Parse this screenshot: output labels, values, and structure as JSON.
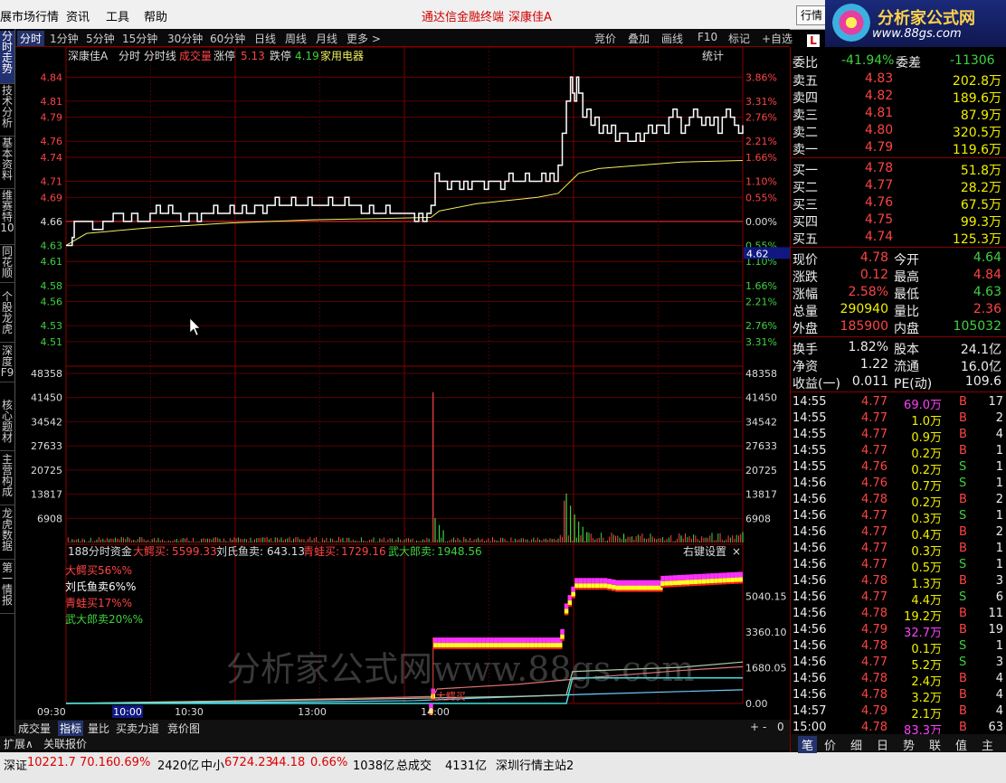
{
  "menubar": {
    "left_title": "展市场行情",
    "items": [
      "资讯",
      "工具",
      "帮助"
    ],
    "promo1": "通达信金融终端",
    "promo2": "深康佳A",
    "hq_button": "行情"
  },
  "logo": {
    "line1": "分析家公式网",
    "line2": "www.88gs.com"
  },
  "left_tabs": [
    "分时走势",
    "技术分析",
    "基本资料",
    "维赛特10",
    "同花顺",
    "个股龙虎",
    "深度F9",
    "核心题材",
    "主营构成",
    "龙虎数据",
    "第一情报"
  ],
  "toolbar": {
    "items": [
      "分时",
      "1分钟",
      "5分钟",
      "15分钟",
      "30分钟",
      "60分钟",
      "日线",
      "周线",
      "月线",
      "更多 >"
    ],
    "right_items": [
      "竞价",
      "叠加",
      "画线",
      "F10",
      "标记",
      "+自选"
    ]
  },
  "chart_header": {
    "stock": "深康佳A",
    "mode": "分时 分时线",
    "vol_label": "成交量",
    "zt_label": "涨停",
    "zt_val": "5.13",
    "dt_label": "跌停",
    "dt_val": "4.19",
    "industry": "家用电器",
    "stats": "统计"
  },
  "fund_header": {
    "title": "188分时资金",
    "s1_label": "大鳄买:",
    "s1_val": "5599.33",
    "s2_label": "刘氏鱼卖:",
    "s2_val": "643.13",
    "s3_label": "青蛙买:",
    "s3_val": "1729.16",
    "s4_label": "武大郎卖:",
    "s4_val": "1948.56",
    "settings": "右键设置"
  },
  "fund_legend": [
    "大鳄买56%%",
    "刘氏鱼卖6%%",
    "青蛙买17%%",
    "武大郎卖20%%"
  ],
  "fund_marker": "大鳄买",
  "watermark": "分析家公式网www.88gs.com",
  "bottom_tabs": [
    "成交量",
    "指标",
    "量比",
    "买卖力道",
    "竞价图"
  ],
  "bottom_right": [
    "+",
    "-",
    "0"
  ],
  "ext_tabs": [
    "扩展∧",
    "关联报价"
  ],
  "statusbar": {
    "sz_label": "深证",
    "sz_val": "10221.7",
    "sz_chg": "70.16",
    "sz_pct": "0.69%",
    "sz_amt": "2420亿",
    "zx_label": "中小",
    "zx_val": "6724.23",
    "zx_chg": "44.18",
    "zx_pct": "0.66%",
    "zx_amt": "1038亿",
    "total_label": "总成交",
    "total_val": "4131亿",
    "station": "深圳行情主站2"
  },
  "right_panel": {
    "commission": {
      "wb_label": "委比",
      "wb_val": "-41.94%",
      "wc_label": "委差",
      "wc_val": "-11306"
    },
    "sells": [
      {
        "label": "卖五",
        "price": "4.83",
        "vol": "202.8万"
      },
      {
        "label": "卖四",
        "price": "4.82",
        "vol": "189.6万"
      },
      {
        "label": "卖三",
        "price": "4.81",
        "vol": "87.9万"
      },
      {
        "label": "卖二",
        "price": "4.80",
        "vol": "320.5万"
      },
      {
        "label": "卖一",
        "price": "4.79",
        "vol": "119.6万"
      }
    ],
    "buys": [
      {
        "label": "买一",
        "price": "4.78",
        "vol": "51.8万"
      },
      {
        "label": "买二",
        "price": "4.77",
        "vol": "28.2万"
      },
      {
        "label": "买三",
        "price": "4.76",
        "vol": "67.5万"
      },
      {
        "label": "买四",
        "price": "4.75",
        "vol": "99.3万"
      },
      {
        "label": "买五",
        "price": "4.74",
        "vol": "125.3万"
      }
    ],
    "quote": [
      {
        "l1": "现价",
        "v1": "4.78",
        "l2": "今开",
        "v2": "4.64",
        "c1": "red",
        "c2": "grn"
      },
      {
        "l1": "涨跌",
        "v1": "0.12",
        "l2": "最高",
        "v2": "4.84",
        "c1": "red",
        "c2": "red"
      },
      {
        "l1": "涨幅",
        "v1": "2.58%",
        "l2": "最低",
        "v2": "4.63",
        "c1": "red",
        "c2": "grn"
      },
      {
        "l1": "总量",
        "v1": "290940",
        "l2": "量比",
        "v2": "2.36",
        "c1": "yel",
        "c2": "red"
      },
      {
        "l1": "外盘",
        "v1": "185900",
        "l2": "内盘",
        "v2": "105032",
        "c1": "red",
        "c2": "grn"
      }
    ],
    "fin": [
      {
        "l1": "换手",
        "v1": "1.82%",
        "l2": "股本",
        "v2": "24.1亿"
      },
      {
        "l1": "净资",
        "v1": "1.22",
        "l2": "流通",
        "v2": "16.0亿"
      },
      {
        "l1": "收益(一)",
        "v1": "0.011",
        "l2": "PE(动)",
        "v2": "109.6"
      }
    ],
    "ticks": [
      {
        "t": "14:55",
        "p": "4.77",
        "v": "69.0万",
        "d": "B",
        "n": "17",
        "pc": "red",
        "vc": "mag"
      },
      {
        "t": "14:55",
        "p": "4.77",
        "v": "1.0万",
        "d": "B",
        "n": "2",
        "pc": "red",
        "vc": "yel"
      },
      {
        "t": "14:55",
        "p": "4.77",
        "v": "0.9万",
        "d": "B",
        "n": "4",
        "pc": "red",
        "vc": "yel"
      },
      {
        "t": "14:55",
        "p": "4.77",
        "v": "0.2万",
        "d": "B",
        "n": "1",
        "pc": "red",
        "vc": "yel"
      },
      {
        "t": "14:55",
        "p": "4.76",
        "v": "0.2万",
        "d": "S",
        "n": "1",
        "pc": "red",
        "vc": "yel"
      },
      {
        "t": "14:56",
        "p": "4.76",
        "v": "0.7万",
        "d": "S",
        "n": "1",
        "pc": "red",
        "vc": "yel"
      },
      {
        "t": "14:56",
        "p": "4.78",
        "v": "0.2万",
        "d": "B",
        "n": "2",
        "pc": "red",
        "vc": "yel"
      },
      {
        "t": "14:56",
        "p": "4.77",
        "v": "0.3万",
        "d": "S",
        "n": "1",
        "pc": "red",
        "vc": "yel"
      },
      {
        "t": "14:56",
        "p": "4.77",
        "v": "0.4万",
        "d": "B",
        "n": "2",
        "pc": "red",
        "vc": "yel"
      },
      {
        "t": "14:56",
        "p": "4.77",
        "v": "0.3万",
        "d": "B",
        "n": "1",
        "pc": "red",
        "vc": "yel"
      },
      {
        "t": "14:56",
        "p": "4.77",
        "v": "0.5万",
        "d": "S",
        "n": "1",
        "pc": "red",
        "vc": "yel"
      },
      {
        "t": "14:56",
        "p": "4.78",
        "v": "1.3万",
        "d": "B",
        "n": "3",
        "pc": "red",
        "vc": "yel"
      },
      {
        "t": "14:56",
        "p": "4.77",
        "v": "4.4万",
        "d": "S",
        "n": "6",
        "pc": "red",
        "vc": "yel"
      },
      {
        "t": "14:56",
        "p": "4.78",
        "v": "19.2万",
        "d": "B",
        "n": "11",
        "pc": "red",
        "vc": "yel"
      },
      {
        "t": "14:56",
        "p": "4.79",
        "v": "32.7万",
        "d": "B",
        "n": "19",
        "pc": "red",
        "vc": "mag"
      },
      {
        "t": "14:56",
        "p": "4.78",
        "v": "0.1万",
        "d": "S",
        "n": "1",
        "pc": "red",
        "vc": "yel"
      },
      {
        "t": "14:56",
        "p": "4.77",
        "v": "5.2万",
        "d": "S",
        "n": "3",
        "pc": "red",
        "vc": "yel"
      },
      {
        "t": "14:56",
        "p": "4.78",
        "v": "2.4万",
        "d": "B",
        "n": "4",
        "pc": "red",
        "vc": "yel"
      },
      {
        "t": "14:56",
        "p": "4.78",
        "v": "3.2万",
        "d": "B",
        "n": "4",
        "pc": "red",
        "vc": "yel"
      },
      {
        "t": "14:57",
        "p": "4.79",
        "v": "2.1万",
        "d": "B",
        "n": "4",
        "pc": "red",
        "vc": "yel"
      },
      {
        "t": "15:00",
        "p": "4.78",
        "v": "83.3万",
        "d": "B",
        "n": "63",
        "pc": "red",
        "vc": "mag"
      }
    ],
    "bottom_tabs": [
      "笔",
      "价",
      "细",
      "日",
      "势",
      "联",
      "值",
      "主"
    ],
    "l_icon": "L"
  },
  "colors": {
    "price_line": "#ffffff",
    "avg_line": "#f0f060",
    "up": "#ff4444",
    "down": "#3fd23f",
    "grid": "#8b0000"
  },
  "chart_data": {
    "type": "line",
    "title": "深康佳A 分时线",
    "price_ylim": [
      4.485,
      4.855
    ],
    "preclose": 4.66,
    "price_ticks": [
      "4.84",
      "4.81",
      "4.79",
      "4.76",
      "4.74",
      "4.71",
      "4.69",
      "4.66",
      "4.63",
      "4.61",
      "4.58",
      "4.56",
      "4.53",
      "4.51"
    ],
    "pct_ticks": [
      "3.86%",
      "3.31%",
      "2.76%",
      "2.21%",
      "1.66%",
      "1.10%",
      "0.55%",
      "0.00%",
      "0.55%",
      "1.10%",
      "1.66%",
      "2.21%",
      "2.76%",
      "3.31%"
    ],
    "current_tag": "4.62",
    "vol_ticks": [
      "48358",
      "41450",
      "34542",
      "27633",
      "20725",
      "13817",
      "6908"
    ],
    "vol_ylim": [
      0,
      48358
    ],
    "fund_ticks": [
      "5040.15",
      "3360.10",
      "1680.05",
      "0.00"
    ],
    "fund_ylim": [
      0,
      6720
    ],
    "x_ticks": [
      "09:30",
      "10:00",
      "10:30",
      "13:00",
      "14:00"
    ],
    "price": [
      [
        0,
        4.63
      ],
      [
        2,
        4.63
      ],
      [
        3,
        4.64
      ],
      [
        4,
        4.66
      ],
      [
        12,
        4.66
      ],
      [
        13,
        4.65
      ],
      [
        17,
        4.65
      ],
      [
        18,
        4.66
      ],
      [
        22,
        4.66
      ],
      [
        23,
        4.67
      ],
      [
        27,
        4.67
      ],
      [
        28,
        4.66
      ],
      [
        30,
        4.66
      ],
      [
        32,
        4.67
      ],
      [
        34,
        4.67
      ],
      [
        35,
        4.66
      ],
      [
        40,
        4.66
      ],
      [
        41,
        4.67
      ],
      [
        43,
        4.67
      ],
      [
        44,
        4.68
      ],
      [
        46,
        4.67
      ],
      [
        48,
        4.67
      ],
      [
        50,
        4.68
      ],
      [
        52,
        4.67
      ],
      [
        55,
        4.67
      ],
      [
        56,
        4.66
      ],
      [
        58,
        4.66
      ],
      [
        60,
        4.67
      ],
      [
        62,
        4.67
      ],
      [
        64,
        4.66
      ],
      [
        66,
        4.67
      ],
      [
        70,
        4.67
      ],
      [
        72,
        4.68
      ],
      [
        74,
        4.67
      ],
      [
        78,
        4.67
      ],
      [
        80,
        4.68
      ],
      [
        82,
        4.67
      ],
      [
        84,
        4.67
      ],
      [
        86,
        4.68
      ],
      [
        88,
        4.67
      ],
      [
        92,
        4.68
      ],
      [
        94,
        4.68
      ],
      [
        96,
        4.67
      ],
      [
        98,
        4.68
      ],
      [
        102,
        4.69
      ],
      [
        104,
        4.68
      ],
      [
        108,
        4.68
      ],
      [
        110,
        4.69
      ],
      [
        112,
        4.68
      ],
      [
        116,
        4.68
      ],
      [
        118,
        4.69
      ],
      [
        120,
        4.68
      ],
      [
        126,
        4.68
      ],
      [
        128,
        4.69
      ],
      [
        130,
        4.68
      ],
      [
        134,
        4.68
      ],
      [
        136,
        4.69
      ],
      [
        138,
        4.68
      ],
      [
        142,
        4.68
      ],
      [
        144,
        4.67
      ],
      [
        146,
        4.67
      ],
      [
        148,
        4.68
      ],
      [
        150,
        4.67
      ],
      [
        154,
        4.67
      ],
      [
        156,
        4.68
      ],
      [
        158,
        4.67
      ],
      [
        168,
        4.67
      ],
      [
        170,
        4.66
      ],
      [
        172,
        4.67
      ],
      [
        174,
        4.66
      ],
      [
        176,
        4.67
      ],
      [
        178,
        4.68
      ],
      [
        180,
        4.72
      ],
      [
        182,
        4.71
      ],
      [
        184,
        4.71
      ],
      [
        186,
        4.7
      ],
      [
        188,
        4.71
      ],
      [
        190,
        4.71
      ],
      [
        192,
        4.7
      ],
      [
        194,
        4.71
      ],
      [
        196,
        4.7
      ],
      [
        198,
        4.71
      ],
      [
        202,
        4.71
      ],
      [
        204,
        4.7
      ],
      [
        206,
        4.71
      ],
      [
        210,
        4.71
      ],
      [
        212,
        4.7
      ],
      [
        214,
        4.71
      ],
      [
        216,
        4.72
      ],
      [
        218,
        4.71
      ],
      [
        222,
        4.71
      ],
      [
        224,
        4.72
      ],
      [
        226,
        4.71
      ],
      [
        230,
        4.71
      ],
      [
        232,
        4.72
      ],
      [
        234,
        4.71
      ],
      [
        236,
        4.72
      ],
      [
        238,
        4.71
      ],
      [
        240,
        4.73
      ],
      [
        242,
        4.77
      ],
      [
        244,
        4.81
      ],
      [
        246,
        4.84
      ],
      [
        247,
        4.82
      ],
      [
        248,
        4.81
      ],
      [
        249,
        4.84
      ],
      [
        250,
        4.82
      ],
      [
        252,
        4.79
      ],
      [
        254,
        4.8
      ],
      [
        256,
        4.78
      ],
      [
        258,
        4.79
      ],
      [
        260,
        4.77
      ],
      [
        262,
        4.78
      ],
      [
        264,
        4.77
      ],
      [
        266,
        4.78
      ],
      [
        268,
        4.76
      ],
      [
        270,
        4.77
      ],
      [
        272,
        4.77
      ],
      [
        274,
        4.76
      ],
      [
        276,
        4.76
      ],
      [
        278,
        4.77
      ],
      [
        280,
        4.76
      ],
      [
        282,
        4.77
      ],
      [
        284,
        4.78
      ],
      [
        286,
        4.77
      ],
      [
        288,
        4.78
      ],
      [
        290,
        4.78
      ],
      [
        292,
        4.77
      ],
      [
        294,
        4.79
      ],
      [
        296,
        4.8
      ],
      [
        298,
        4.79
      ],
      [
        300,
        4.77
      ],
      [
        302,
        4.78
      ],
      [
        304,
        4.79
      ],
      [
        306,
        4.8
      ],
      [
        308,
        4.79
      ],
      [
        310,
        4.78
      ],
      [
        312,
        4.79
      ],
      [
        314,
        4.78
      ],
      [
        316,
        4.79
      ],
      [
        318,
        4.77
      ],
      [
        320,
        4.79
      ],
      [
        322,
        4.8
      ],
      [
        324,
        4.79
      ],
      [
        326,
        4.78
      ],
      [
        328,
        4.77
      ],
      [
        330,
        4.78
      ]
    ],
    "avg": [
      [
        0,
        4.63
      ],
      [
        10,
        4.645
      ],
      [
        40,
        4.652
      ],
      [
        80,
        4.658
      ],
      [
        120,
        4.662
      ],
      [
        160,
        4.664
      ],
      [
        178,
        4.665
      ],
      [
        182,
        4.673
      ],
      [
        200,
        4.682
      ],
      [
        230,
        4.69
      ],
      [
        240,
        4.695
      ],
      [
        246,
        4.71
      ],
      [
        250,
        4.72
      ],
      [
        260,
        4.726
      ],
      [
        280,
        4.73
      ],
      [
        300,
        4.734
      ],
      [
        330,
        4.736
      ]
    ],
    "volume_spikes": [
      [
        179,
        43000
      ],
      [
        180,
        7000
      ],
      [
        182,
        5000
      ],
      [
        184,
        3500
      ],
      [
        243,
        12000
      ],
      [
        244,
        14000
      ],
      [
        246,
        10500
      ],
      [
        248,
        8000
      ],
      [
        250,
        6000
      ],
      [
        252,
        4500
      ],
      [
        254,
        3000
      ],
      [
        272,
        2500
      ],
      [
        300,
        2000
      ],
      [
        330,
        3000
      ]
    ],
    "fund_series": [
      {
        "name": "大鳄买",
        "values": [
          [
            0,
            0
          ],
          [
            177,
            0
          ],
          [
            178,
            700
          ],
          [
            179,
            3100
          ],
          [
            240,
            3100
          ],
          [
            241,
            3500
          ],
          [
            243,
            4700
          ],
          [
            248,
            5900
          ],
          [
            262,
            5900
          ],
          [
            268,
            5800
          ],
          [
            289,
            5800
          ],
          [
            290,
            6000
          ],
          [
            330,
            6200
          ]
        ]
      },
      {
        "name": "刘氏鱼卖",
        "values": [
          [
            0,
            0
          ],
          [
            100,
            60
          ],
          [
            170,
            130
          ],
          [
            200,
            250
          ],
          [
            250,
            420
          ],
          [
            300,
            560
          ],
          [
            330,
            643
          ]
        ]
      },
      {
        "name": "青蛙买",
        "values": [
          [
            0,
            0
          ],
          [
            80,
            120
          ],
          [
            150,
            260
          ],
          [
            179,
            330
          ],
          [
            181,
            680
          ],
          [
            220,
            900
          ],
          [
            260,
            1250
          ],
          [
            300,
            1550
          ],
          [
            330,
            1729
          ]
        ]
      },
      {
        "name": "武大郎卖",
        "values": [
          [
            0,
            0
          ],
          [
            60,
            80
          ],
          [
            150,
            210
          ],
          [
            220,
            330
          ],
          [
            244,
            400
          ],
          [
            247,
            1500
          ],
          [
            300,
            1700
          ],
          [
            330,
            1948
          ]
        ]
      }
    ]
  }
}
